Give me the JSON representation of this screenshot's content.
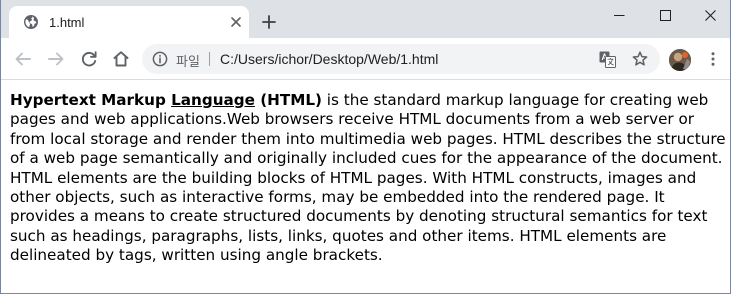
{
  "browser": {
    "tab": {
      "title": "1.html",
      "favicon": "globe-icon"
    },
    "address": {
      "scheme_label": "파일",
      "url": "C:/Users/ichor/Desktop/Web/1.html"
    }
  },
  "page": {
    "term_part1": "Hypertext Markup ",
    "term_link": "Language",
    "term_part2": " (HTML)",
    "body": " is the standard markup language for creating web pages and web applications.Web browsers receive HTML documents from a web server or from local storage and render them into multimedia web pages. HTML describes the structure of a web page semantically and originally included cues for the appearance of the document. HTML elements are the building blocks of HTML pages. With HTML constructs, images and other objects, such as interactive forms, may be embedded into the rendered page. It provides a means to create structured documents by denoting structural semantics for text such as headings, paragraphs, lists, links, quotes and other items. HTML elements are delineated by tags, written using angle brackets."
  },
  "colors": {
    "tabstrip": "#dee1e6",
    "omnibox": "#f1f3f4",
    "icon": "#5f6368",
    "text": "#000000"
  }
}
